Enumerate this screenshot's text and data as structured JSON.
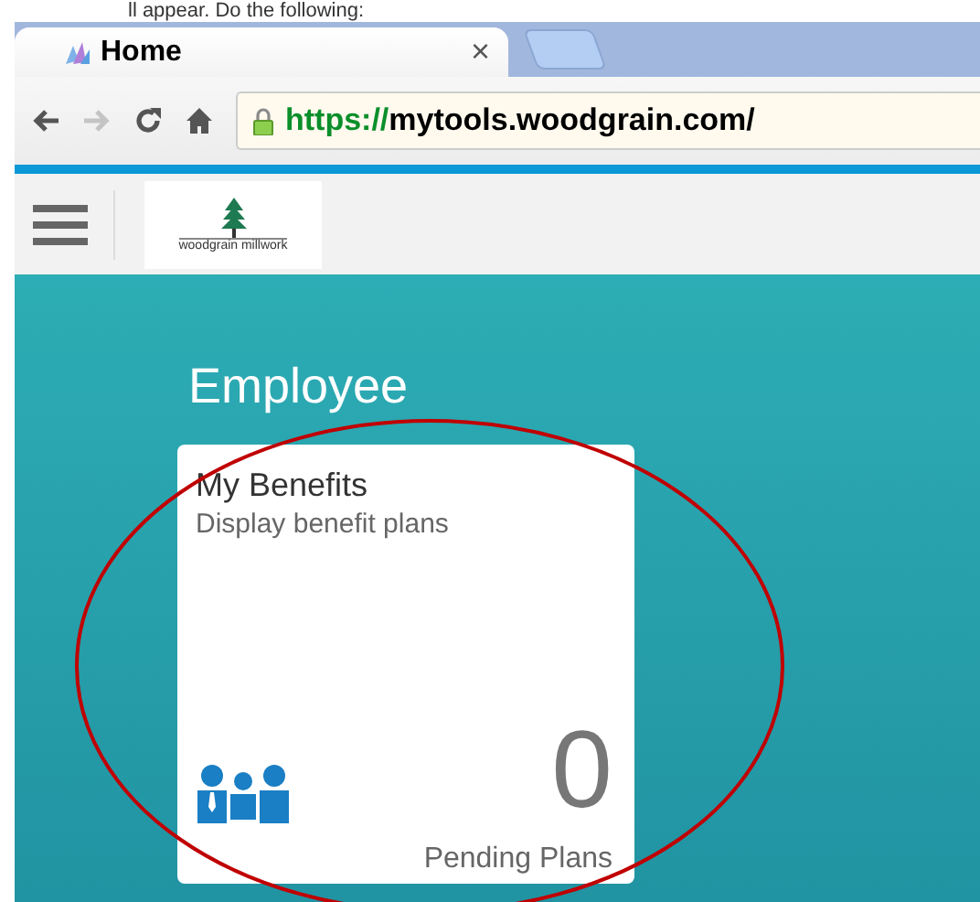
{
  "document_line": "ll appear.  Do the following:",
  "browser": {
    "tab": {
      "title": "Home",
      "close": "×"
    },
    "address": {
      "scheme": "https://",
      "host": "mytools.woodgrain.com/"
    }
  },
  "header": {
    "logo_text": "woodgrain millwork"
  },
  "group": {
    "title": "Employee"
  },
  "tiles": [
    {
      "title": "My Benefits",
      "subtitle": "Display benefit plans",
      "number": "0",
      "footer": "Pending Plans"
    }
  ]
}
